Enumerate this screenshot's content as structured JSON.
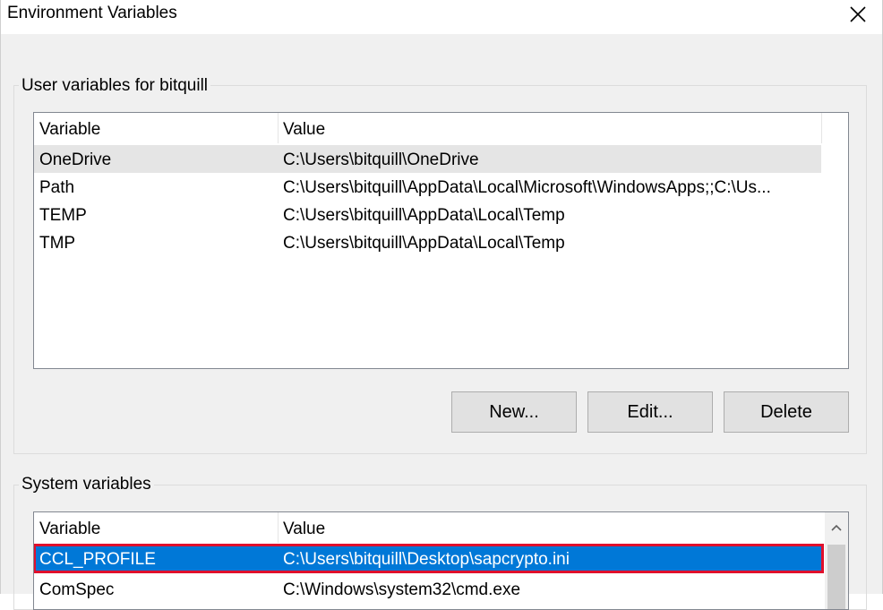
{
  "window": {
    "title": "Environment Variables",
    "close_icon": "close-icon"
  },
  "user_vars": {
    "group_label": "User variables for bitquill",
    "columns": [
      "Variable",
      "Value"
    ],
    "rows": [
      {
        "variable": "OneDrive",
        "value": "C:\\Users\\bitquill\\OneDrive"
      },
      {
        "variable": "Path",
        "value": "C:\\Users\\bitquill\\AppData\\Local\\Microsoft\\WindowsApps;;C:\\Us..."
      },
      {
        "variable": "TEMP",
        "value": "C:\\Users\\bitquill\\AppData\\Local\\Temp"
      },
      {
        "variable": "TMP",
        "value": "C:\\Users\\bitquill\\AppData\\Local\\Temp"
      }
    ],
    "buttons": {
      "new": "New...",
      "edit": "Edit...",
      "delete": "Delete"
    }
  },
  "system_vars": {
    "group_label": "System variables",
    "columns": [
      "Variable",
      "Value"
    ],
    "rows": [
      {
        "variable": "CCL_PROFILE",
        "value": "C:\\Users\\bitquill\\Desktop\\sapcrypto.ini"
      },
      {
        "variable": "ComSpec",
        "value": "C:\\Windows\\system32\\cmd.exe"
      }
    ]
  },
  "colors": {
    "selection": "#0078d7",
    "highlight_outline": "#e0102c",
    "hover_row": "#e5e5e5"
  }
}
